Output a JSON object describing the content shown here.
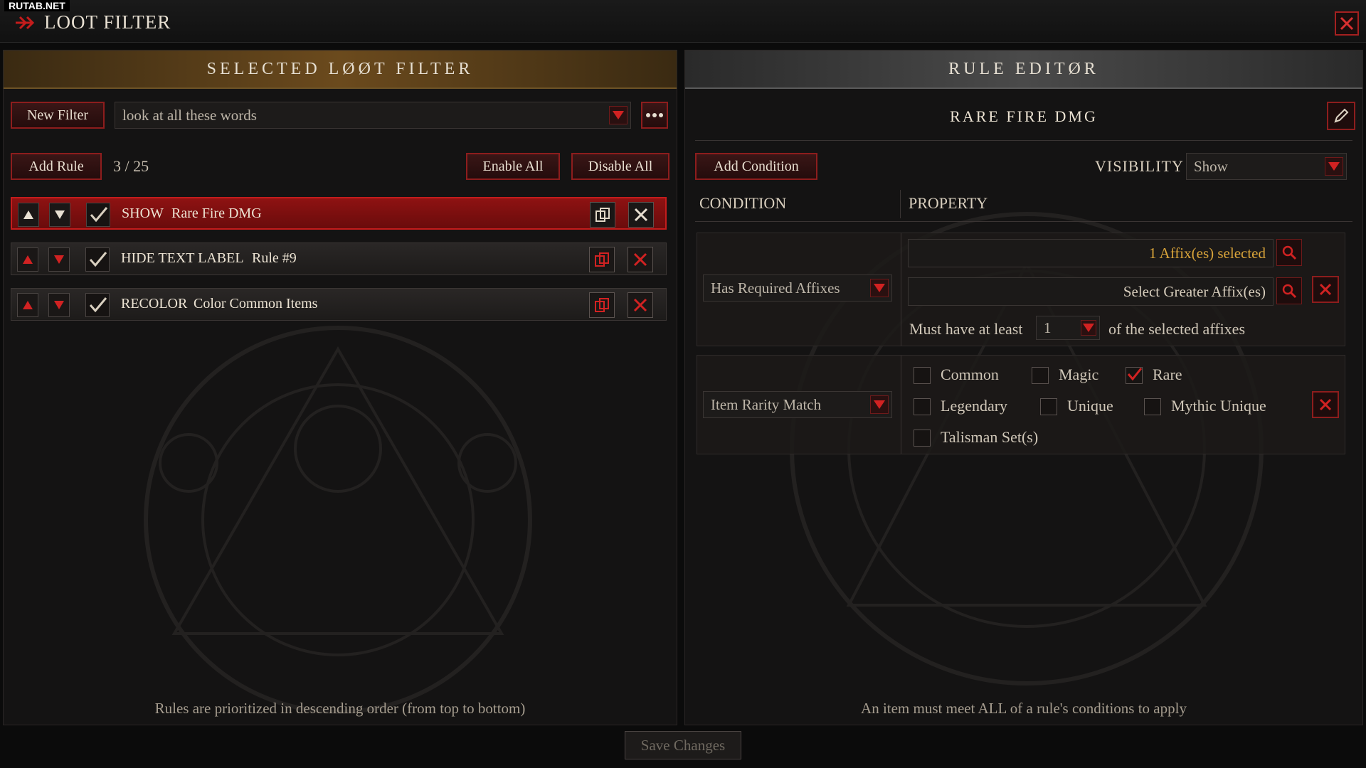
{
  "watermark": "RUTAB.NET",
  "window": {
    "title": "LOOT FILTER"
  },
  "left_panel": {
    "header": "SELECTED LØØT FILTER",
    "new_filter_label": "New Filter",
    "filter_select_value": "look at all these words",
    "add_rule_label": "Add Rule",
    "rule_count": "3 / 25",
    "enable_all_label": "Enable All",
    "disable_all_label": "Disable All",
    "rules": [
      {
        "type": "SHOW",
        "name": "Rare Fire DMG",
        "enabled": true,
        "selected": true
      },
      {
        "type": "HIDE TEXT LABEL",
        "name": "Rule #9",
        "enabled": true,
        "selected": false
      },
      {
        "type": "RECOLOR",
        "name": "Color Common Items",
        "enabled": true,
        "selected": false
      }
    ],
    "footer": "Rules are prioritized in descending order (from top to bottom)"
  },
  "right_panel": {
    "header": "RULE EDITØR",
    "rule_title": "RARE FIRE DMG",
    "add_condition_label": "Add Condition",
    "visibility_label": "VISIBILITY",
    "visibility_value": "Show",
    "col_condition": "CONDITION",
    "col_property": "PROPERTY",
    "conditions": {
      "affixes": {
        "type": "Has Required Affixes",
        "selected_text": "1 Affix(es) selected",
        "greater_text": "Select Greater Affix(es)",
        "must_have_prefix": "Must have at least",
        "must_have_value": "1",
        "must_have_suffix": "of the selected affixes"
      },
      "rarity": {
        "type": "Item Rarity Match",
        "options": [
          {
            "label": "Common",
            "checked": false
          },
          {
            "label": "Magic",
            "checked": false
          },
          {
            "label": "Rare",
            "checked": true
          },
          {
            "label": "Legendary",
            "checked": false
          },
          {
            "label": "Unique",
            "checked": false
          },
          {
            "label": "Mythic Unique",
            "checked": false
          },
          {
            "label": "Talisman Set(s)",
            "checked": false
          }
        ]
      }
    },
    "footer": "An item must meet ALL of a rule's conditions to apply"
  },
  "save_label": "Save Changes",
  "colors": {
    "accent_red": "#c41c1c",
    "gold": "#6b4a1d",
    "text": "#ece3d3"
  }
}
